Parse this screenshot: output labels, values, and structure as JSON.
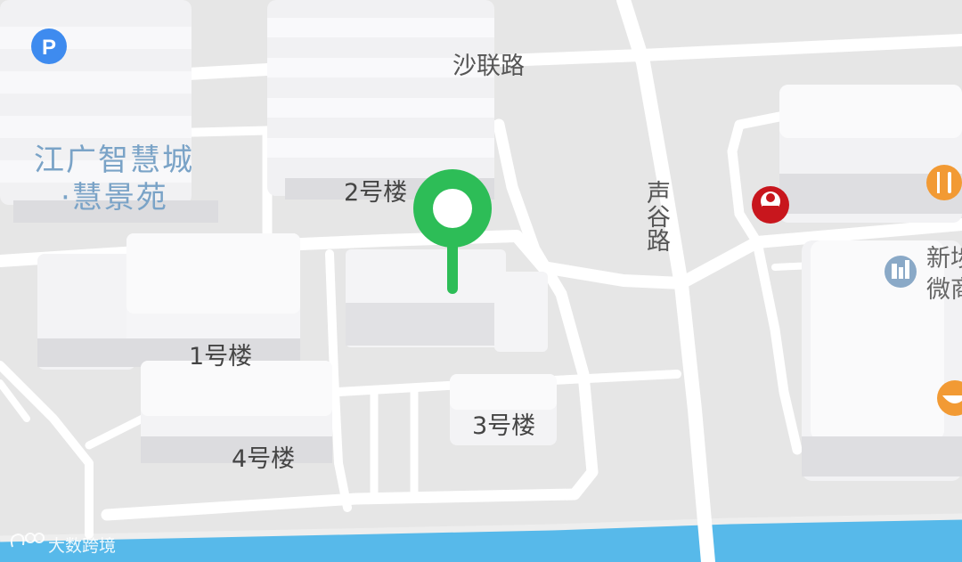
{
  "roads": {
    "shalian": "沙联路",
    "shenggu": "声谷路"
  },
  "buildings": {
    "b1": "1号楼",
    "b2": "2号楼",
    "b3": "3号楼",
    "b4": "4号楼"
  },
  "district": {
    "line1": "江广智慧城",
    "line2": "·慧景苑"
  },
  "poi": {
    "line1": "新埗",
    "line2": "微商"
  },
  "watermark": "大数跨境",
  "colors": {
    "pin": "#2dbd57",
    "water": "#57b9ea",
    "parking": "#3e8bef",
    "kfc": "#c8161d",
    "restaurant": "#f29a34",
    "office": "#8aa9c7"
  },
  "icons": {
    "parking": "parking-icon",
    "kfc": "kfc-icon",
    "restaurant": "fork-knife-icon",
    "office": "office-building-icon",
    "food": "bowl-icon",
    "pin": "location-pin-icon"
  }
}
